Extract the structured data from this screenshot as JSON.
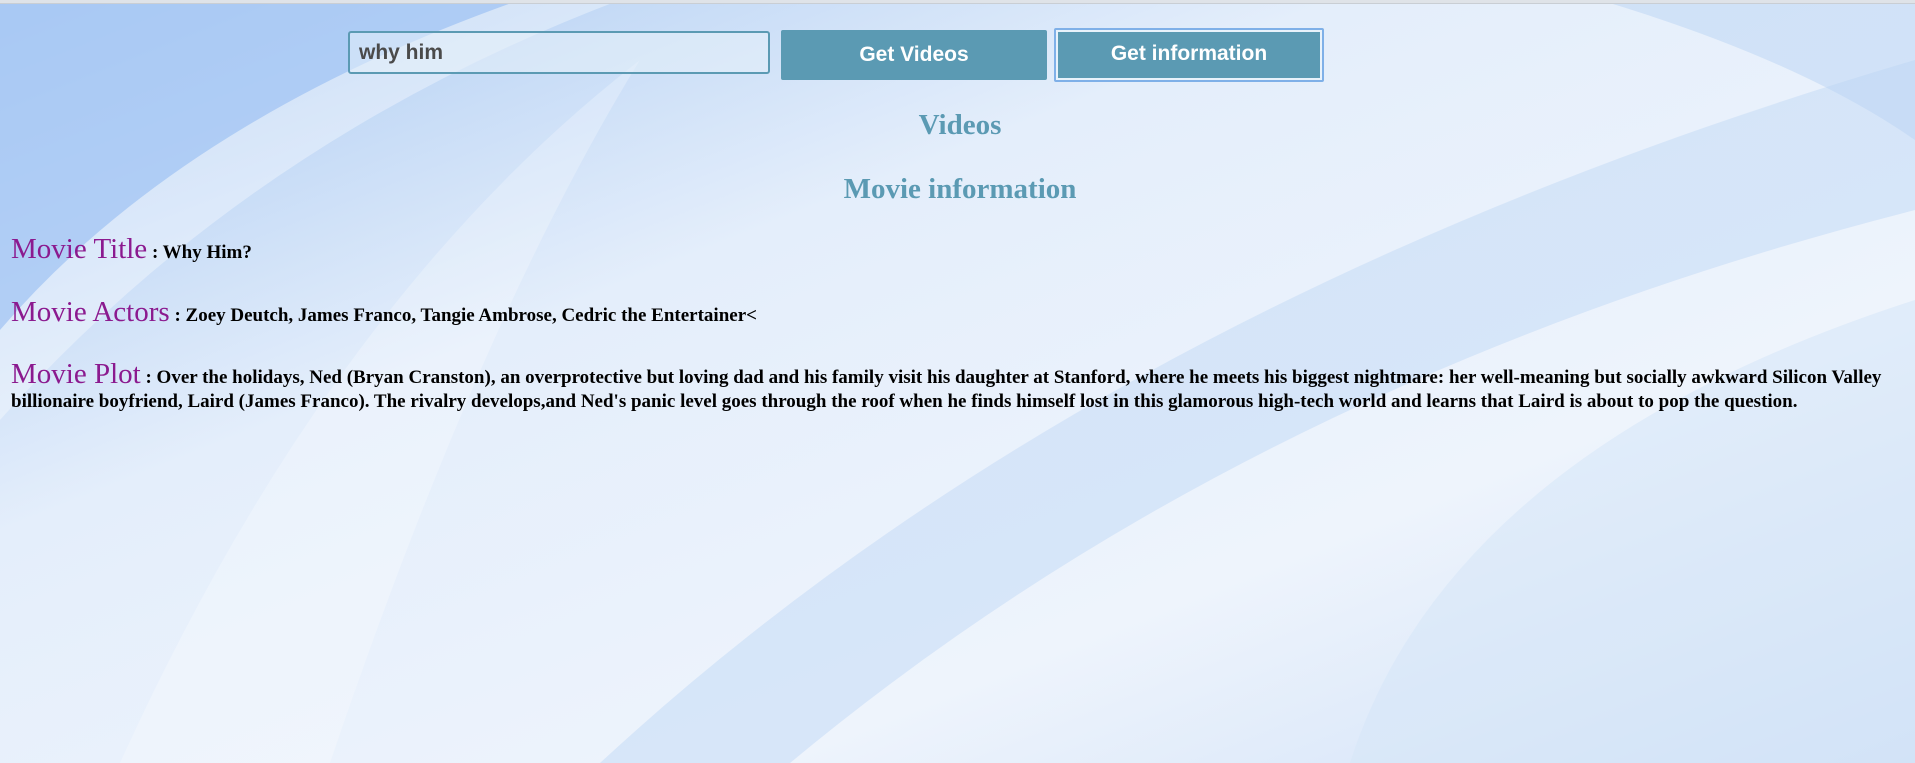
{
  "search": {
    "value": "why him",
    "placeholder": ""
  },
  "buttons": {
    "get_videos": "Get Videos",
    "get_information": "Get information"
  },
  "headings": {
    "videos": "Videos",
    "movie_information": "Movie information"
  },
  "movie": {
    "title_label": "Movie Title",
    "title_value": ": Why Him?",
    "actors_label": "Movie Actors",
    "actors_value": ": Zoey Deutch, James Franco, Tangie Ambrose, Cedric the Entertainer<",
    "plot_label": "Movie Plot",
    "plot_value": ": Over the holidays, Ned (Bryan Cranston), an overprotective but loving dad and his family visit his daughter at Stanford, where he meets his biggest nightmare: her well-meaning but socially awkward Silicon Valley billionaire boyfriend, Laird (James Franco). The rivalry develops,and Ned's panic level goes through the roof when he finds himself lost in this glamorous high-tech world and learns that Laird is about to pop the question."
  },
  "colors": {
    "accent": "#5b9ab3",
    "label": "#8b1a8f",
    "background": "#e6f0fb"
  }
}
